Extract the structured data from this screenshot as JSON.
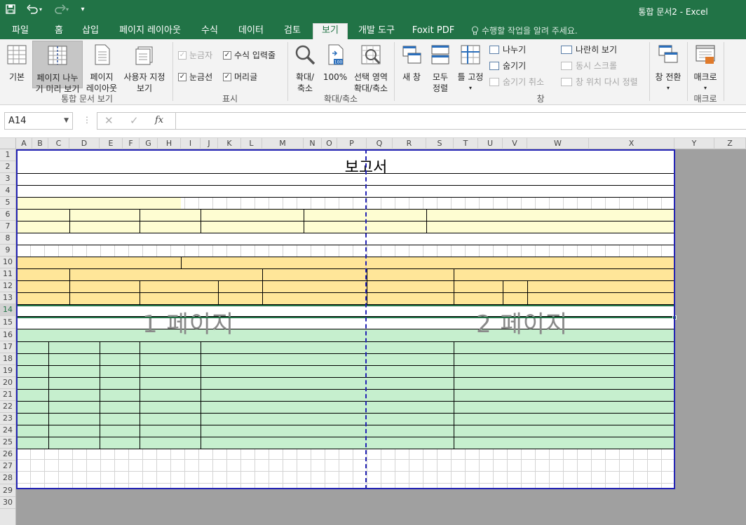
{
  "title_bar": {
    "document_title": "통합 문서2 - Excel"
  },
  "tabs": [
    "파일",
    "홈",
    "삽입",
    "페이지 레이아웃",
    "수식",
    "데이터",
    "검토",
    "보기",
    "개발 도구",
    "Foxit PDF"
  ],
  "active_tab": "보기",
  "tell_me": "수행할 작업을 알려 주세요.",
  "ribbon": {
    "workbook_views": {
      "label": "통합 문서 보기",
      "normal": "기본",
      "page_break_1": "페이지 나누",
      "page_break_2": "기 미리 보기",
      "page_layout_1": "페이지",
      "page_layout_2": "레이아웃",
      "custom_1": "사용자 지정",
      "custom_2": "보기"
    },
    "show": {
      "label": "표시",
      "ruler": "눈금자",
      "formula_bar": "수식 입력줄",
      "gridlines": "눈금선",
      "headings": "머리글"
    },
    "zoom": {
      "label": "확대/축소",
      "zoom_1": "확대/",
      "zoom_2": "축소",
      "zoom100": "100%",
      "zoom_sel_1": "선택 영역",
      "zoom_sel_2": "확대/축소"
    },
    "window": {
      "label": "창",
      "new_window": "새 창",
      "arrange_1": "모두",
      "arrange_2": "정렬",
      "freeze": "틀 고정",
      "split": "나누기",
      "hide": "숨기기",
      "unhide": "숨기기 취소",
      "side_by_side": "나란히 보기",
      "sync_scroll": "동시 스크롤",
      "reset_pos": "창 위치 다시 정렬",
      "switch": "창 전환"
    },
    "macros": {
      "label": "매크로",
      "macros": "매크로"
    }
  },
  "formula_bar": {
    "name_box": "A14",
    "fx": "fx",
    "value": ""
  },
  "columns": [
    "A",
    "B",
    "C",
    "D",
    "E",
    "F",
    "G",
    "H",
    "I",
    "J",
    "K",
    "L",
    "M",
    "N",
    "O",
    "P",
    "Q",
    "R",
    "S",
    "T",
    "U",
    "V",
    "W",
    "X",
    "Y",
    "Z"
  ],
  "rows": [
    "1",
    "2",
    "3",
    "4",
    "5",
    "6",
    "7",
    "8",
    "9",
    "10",
    "11",
    "12",
    "13",
    "14",
    "15",
    "16",
    "17",
    "18",
    "19",
    "20",
    "21",
    "22",
    "23",
    "24",
    "25",
    "26",
    "27",
    "28",
    "29",
    "30"
  ],
  "selected_row": "14",
  "sheet": {
    "report_title": "보고서",
    "page1_watermark": "1 페이지",
    "page2_watermark": "2 페이지"
  }
}
